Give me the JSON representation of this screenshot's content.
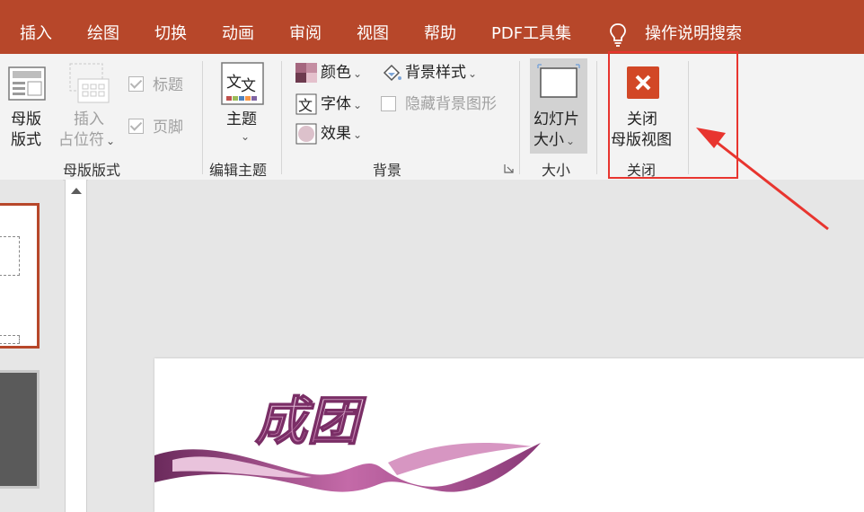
{
  "tabs": {
    "insert": "插入",
    "draw": "绘图",
    "transitions": "切换",
    "animations": "动画",
    "review": "审阅",
    "view": "视图",
    "help": "帮助",
    "pdf_tools": "PDF工具集",
    "search": "操作说明搜索"
  },
  "ribbon": {
    "master_layout": {
      "master_layout_btn_line1": "母版",
      "master_layout_btn_line2": "版式",
      "insert_placeholder_line1": "插入",
      "insert_placeholder_line2": "占位符",
      "title_checkbox": "标题",
      "title_checked": true,
      "footer_checkbox": "页脚",
      "footer_checked": true,
      "label": "母版版式"
    },
    "edit_theme": {
      "themes_btn": "主题",
      "label": "编辑主题"
    },
    "background": {
      "colors": "颜色",
      "fonts": "字体",
      "effects": "效果",
      "background_styles": "背景样式",
      "hide_background_graphics": "隐藏背景图形",
      "hide_background_checked": false,
      "label": "背景"
    },
    "size": {
      "slide_size_line1": "幻灯片",
      "slide_size_line2": "大小",
      "label": "大小"
    },
    "close": {
      "close_master_line1": "关闭",
      "close_master_line2": "母版视图",
      "label": "关闭"
    }
  },
  "slide": {
    "logo_text": "成团"
  },
  "colors": {
    "accent": "#b7472a",
    "close_icon": "#d24726",
    "highlight": "#e8352f"
  }
}
